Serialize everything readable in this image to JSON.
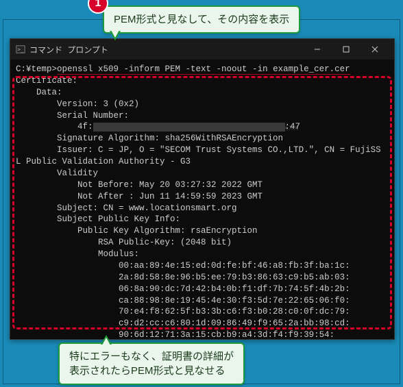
{
  "window": {
    "title": "コマンド プロンプト"
  },
  "callouts": {
    "top_badge": "1",
    "top_text": "PEM形式と見なして、その内容を表示",
    "bottom_line1": "特にエラーもなく、証明書の詳細が",
    "bottom_line2": "表示されたらPEM形式と見なせる"
  },
  "terminal": {
    "prompt": "C:¥temp>",
    "command": "openssl x509 -inform PEM -text -noout -in example_cer.cer",
    "lines": {
      "l0": "Certificate:",
      "l1": "    Data:",
      "l2": "        Version: 3 (0x2)",
      "l3": "        Serial Number:",
      "l4a": "            4f:",
      "l4b": ":47",
      "l5": "        Signature Algorithm: sha256WithRSAEncryption",
      "l6": "        Issuer: C = JP, O = \"SECOM Trust Systems CO.,LTD.\", CN = FujiSS",
      "l7": "L Public Validation Authority - G3",
      "l8": "        Validity",
      "l9": "            Not Before: May 20 03:27:32 2022 GMT",
      "l10": "            Not After : Jun 11 14:59:59 2023 GMT",
      "l11": "        Subject: CN = www.locationsmart.org",
      "l12": "        Subject Public Key Info:",
      "l13": "            Public Key Algorithm: rsaEncryption",
      "l14": "                RSA Public-Key: (2048 bit)",
      "l15": "                Modulus:",
      "l16": "                    00:aa:89:4e:15:ed:0d:fe:bf:46:a8:fb:3f:ba:1c:",
      "l17": "                    2a:8d:58:8e:96:b5:ee:79:b3:86:63:c9:b5:ab:03:",
      "l18": "                    06:8a:90:dc:7d:42:b4:0b:f1:df:7b:74:5f:4b:2b:",
      "l19": "                    ca:88:98:8e:19:45:4e:30:f3:5d:7e:22:65:06:f0:",
      "l20": "                    70:e4:f8:62:5f:b3:3b:c6:f3:b0:28:c0:0f:dc:79:",
      "l21": "                    c9:d2:cc:c6:80:1d:09:86:49:f9:65:2a:bb:98:cd:",
      "l22": "                    90:6d:12:71:3a:15:cb:b9:a4:3d:f4:f9:39:54:"
    }
  }
}
